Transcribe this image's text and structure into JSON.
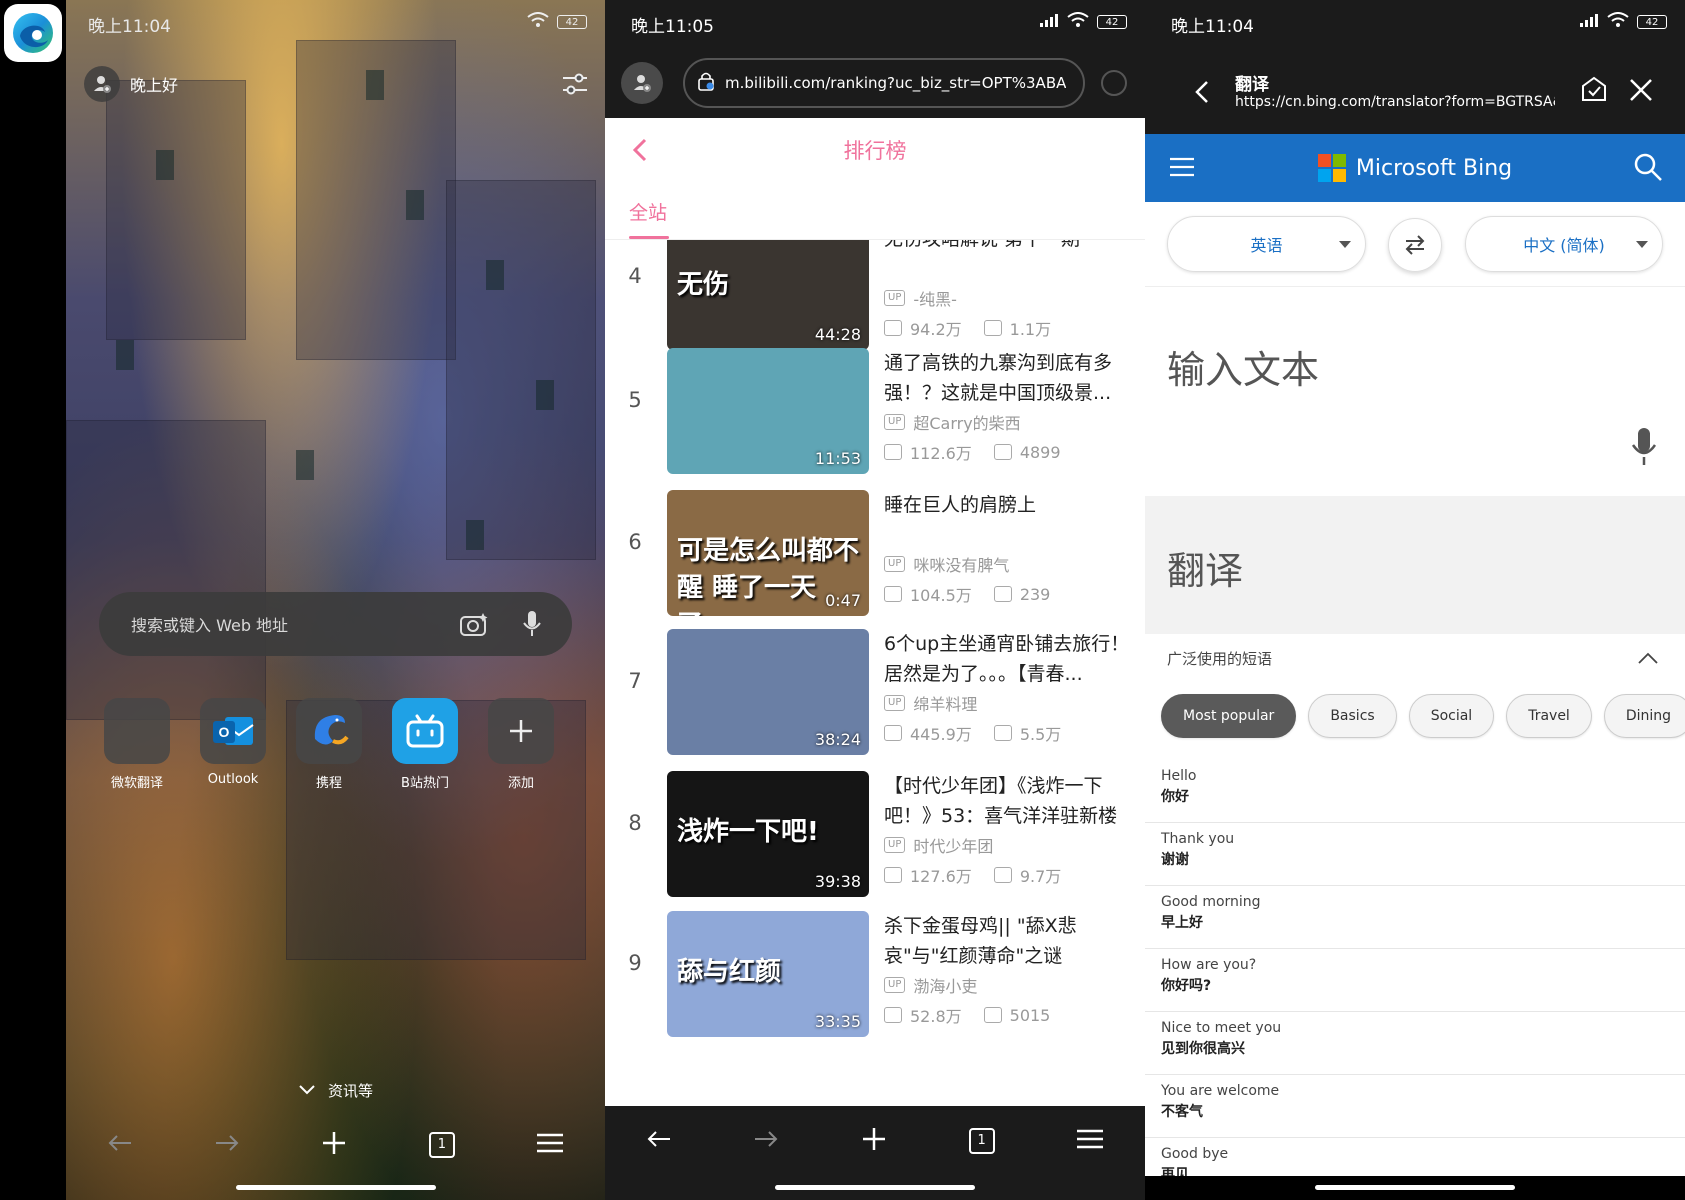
{
  "panel_edge": {
    "status_time": "晚上11:04",
    "battery": "42",
    "greeting": "晚上好",
    "search_placeholder": "搜索或键入 Web 地址",
    "apps": [
      {
        "label": "微软翻译",
        "icon": "blank-tile-icon"
      },
      {
        "label": "Outlook",
        "icon": "outlook-icon"
      },
      {
        "label": "携程",
        "icon": "ctrip-dolphin-icon"
      },
      {
        "label": "B站热门",
        "icon": "bilibili-icon"
      },
      {
        "label": "添加",
        "icon": "plus-icon"
      }
    ],
    "news_label": "资讯等",
    "tab_count": "1"
  },
  "panel_bili": {
    "status_time": "晚上11:05",
    "battery": "42",
    "url": "m.bilibili.com/ranking?uc_biz_str=OPT%3ABA",
    "page_title": "排行榜",
    "tab_all": "全站",
    "tab_count": "1",
    "up_badge": "UP",
    "items": [
      {
        "rank": "4",
        "title": "无伤攻略解说 第十一期",
        "up": "-纯黑-",
        "views": "94.2万",
        "danmaku": "1.1万",
        "duration": "44:28",
        "thumb_text": "无伤",
        "thumb_color": "#3a3530"
      },
      {
        "rank": "5",
        "title": "通了高铁的九寨沟到底有多强！？这就是中国顶级景...",
        "up": "超Carry的柴西",
        "views": "112.6万",
        "danmaku": "4899",
        "duration": "11:53",
        "thumb_text": "",
        "thumb_color": "#5fa5b5"
      },
      {
        "rank": "6",
        "title": "睡在巨人的肩膀上",
        "up": "咪咪没有脾气",
        "views": "104.5万",
        "danmaku": "239",
        "duration": "0:47",
        "thumb_text": "可是怎么叫都不醒 睡了一天了……",
        "thumb_color": "#8a6a45"
      },
      {
        "rank": "7",
        "title": "6个up主坐通宵卧铺去旅行！居然是为了。。。【青春...",
        "up": "绵羊料理",
        "views": "445.9万",
        "danmaku": "5.5万",
        "duration": "38:24",
        "thumb_text": "",
        "thumb_color": "#6a7fa5"
      },
      {
        "rank": "8",
        "title": "【时代少年团】《浅炸一下吧！》53：喜气洋洋驻新楼",
        "up": "时代少年团",
        "views": "127.6万",
        "danmaku": "9.7万",
        "duration": "39:38",
        "thumb_text": "浅炸一下吧!",
        "thumb_color": "#151515"
      },
      {
        "rank": "9",
        "title": "杀下金蛋母鸡|| \"舔X悲哀\"与\"红颜薄命\"之谜",
        "up": "渤海小吏",
        "views": "52.8万",
        "danmaku": "5015",
        "duration": "33:35",
        "thumb_text": "舔与红颜",
        "thumb_color": "#8fa8d8"
      }
    ]
  },
  "panel_bing": {
    "status_time": "晚上11:04",
    "battery": "42",
    "nav_title": "翻译",
    "nav_url": "https://cn.bing.com/translator?form=BGTRSA&se",
    "brand": "Microsoft Bing",
    "source_lang": "英语",
    "target_lang": "中文 (简体)",
    "input_placeholder": "输入文本",
    "output_placeholder": "翻译",
    "phrases_label": "广泛使用的短语",
    "chips": [
      "Most popular",
      "Basics",
      "Social",
      "Travel",
      "Dining"
    ],
    "phrases": [
      {
        "en": "Hello",
        "zh": "你好"
      },
      {
        "en": "Thank you",
        "zh": "谢谢"
      },
      {
        "en": "Good morning",
        "zh": "早上好"
      },
      {
        "en": "How are you?",
        "zh": "你好吗?"
      },
      {
        "en": "Nice to meet you",
        "zh": "见到你很高兴"
      },
      {
        "en": "You are welcome",
        "zh": "不客气"
      },
      {
        "en": "Good bye",
        "zh": "再见"
      }
    ]
  },
  "colors": {
    "bili_pink": "#f0729c",
    "bing_blue": "#1a6fc4",
    "dark_bar": "#1b1b1b"
  }
}
